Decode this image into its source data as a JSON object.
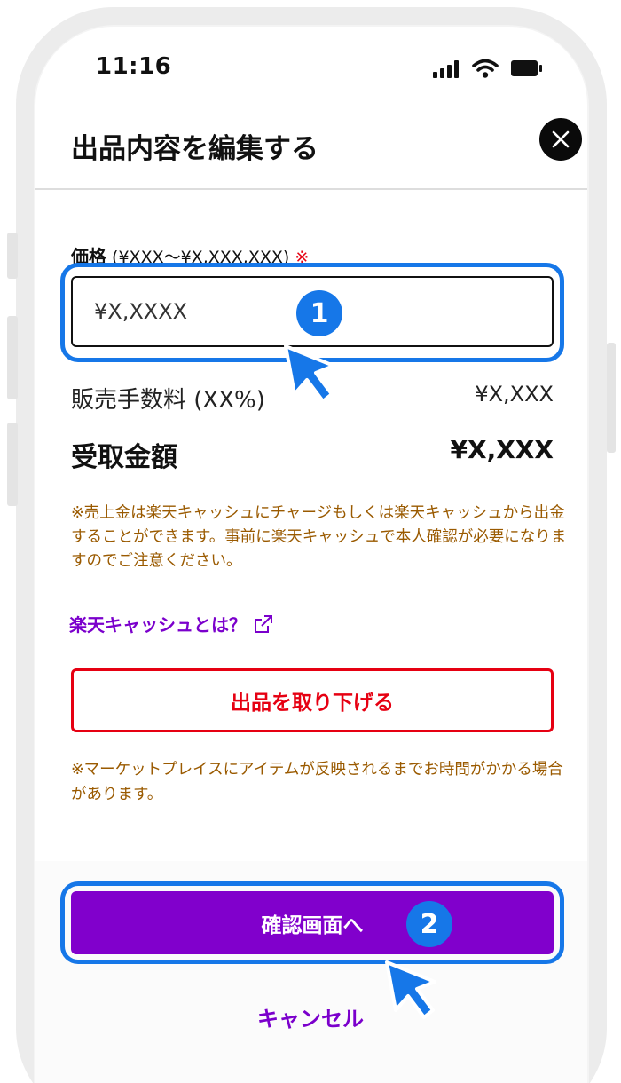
{
  "status_bar": {
    "time": "11:16",
    "icons": [
      "cellular-signal-icon",
      "wifi-icon",
      "battery-icon"
    ]
  },
  "header": {
    "title": "出品内容を編集する",
    "close_icon": "close-icon"
  },
  "price": {
    "label": "価格",
    "range": "(¥XXX〜¥X,XXX,XXX)",
    "required_mark": "※",
    "value": "¥X,XXXX"
  },
  "fee": {
    "label": "販売手数料 (XX%)",
    "value": "¥X,XXX"
  },
  "received": {
    "label": "受取金額",
    "value": "¥X,XXX"
  },
  "notice_1": "※売上金は楽天キャッシュにチャージもしくは楽天キャッシュから出金することができます。事前に楽天キャッシュで本人確認が必要になりますのでご注意ください。",
  "cash_link": {
    "label": "楽天キャッシュとは？",
    "icon": "external-link-icon"
  },
  "withdraw_button": "出品を取り下げる",
  "notice_2": "※マーケットプレイスにアイテムが反映されるまでお時間がかかる場合があります。",
  "confirm_button": "確認画面へ",
  "cancel_button": "キャンセル",
  "annotations": {
    "step_1": "1",
    "step_2": "2"
  },
  "colors": {
    "accent_purple": "#8100cc",
    "danger_red": "#e60012",
    "notice_brown": "#9a5a00",
    "annotation_blue": "#1677e8"
  }
}
